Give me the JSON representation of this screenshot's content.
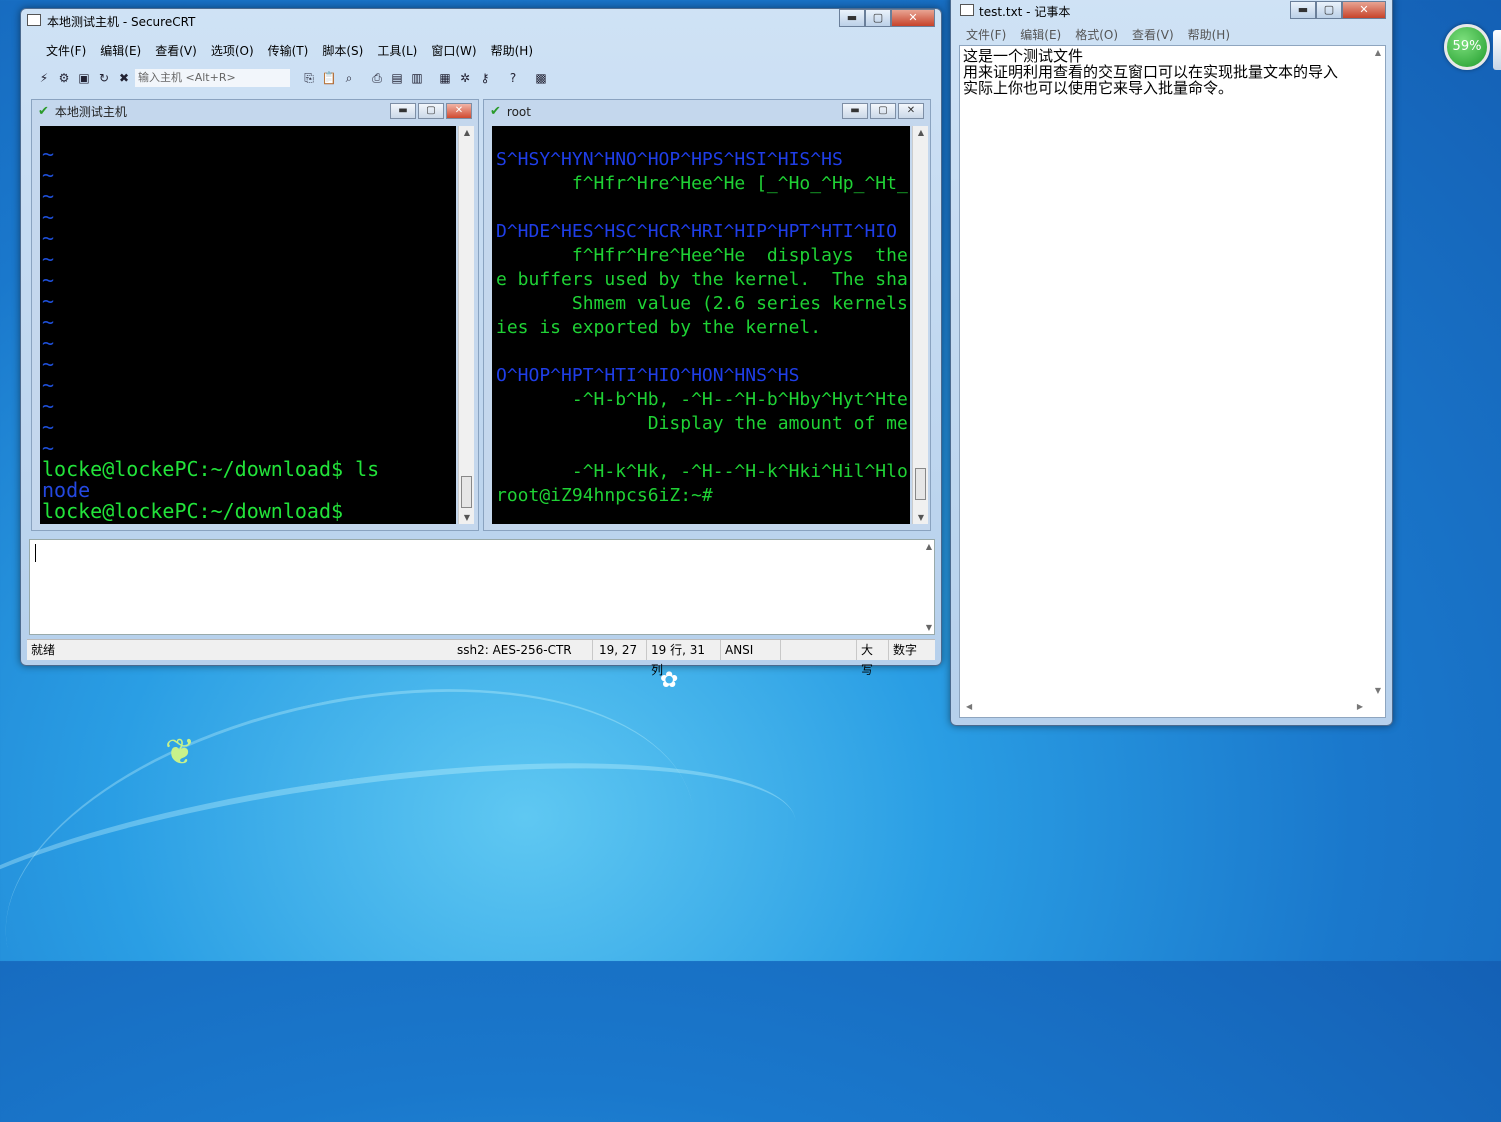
{
  "securecrt": {
    "title": "本地测试主机 - SecureCRT",
    "caption_min": "▬",
    "caption_max": "▢",
    "caption_close": "✕",
    "menu": [
      "文件(F)",
      "编辑(E)",
      "查看(V)",
      "选项(O)",
      "传输(T)",
      "脚本(S)",
      "工具(L)",
      "窗口(W)",
      "帮助(H)"
    ],
    "quick_connect_placeholder": "输入主机 <Alt+R>",
    "pane_left": {
      "title": "本地测试主机",
      "tilde_count": 15,
      "lines": [
        {
          "text": "locke@lockePC:~/download$ ls",
          "color": "green"
        },
        {
          "text": "node",
          "color": "blue"
        },
        {
          "text": "locke@lockePC:~/download$",
          "color": "green"
        }
      ]
    },
    "pane_right": {
      "title": "root",
      "lines": [
        {
          "text": "S^HSY^HYN^HNO^HOP^HPS^HSI^HIS^HS",
          "color": "blue"
        },
        {
          "text": "       f^Hfr^Hre^Hee^He [_^Ho_^Hp_^Ht_",
          "color": "green"
        },
        {
          "text": "",
          "color": "green"
        },
        {
          "text": "D^HDE^HES^HSC^HCR^HRI^HIP^HPT^HTI^HIO",
          "color": "blue"
        },
        {
          "text": "       f^Hfr^Hre^Hee^He  displays  the",
          "color": "green"
        },
        {
          "text": "e buffers used by the kernel.  The sha",
          "color": "green"
        },
        {
          "text": "       Shmem value (2.6 series kernels",
          "color": "green"
        },
        {
          "text": "ies is exported by the kernel.",
          "color": "green"
        },
        {
          "text": "",
          "color": "green"
        },
        {
          "text": "O^HOP^HPT^HTI^HIO^HON^HNS^HS",
          "color": "blue"
        },
        {
          "text": "       -^H-b^Hb, -^H--^H-b^Hby^Hyt^Hte",
          "color": "green"
        },
        {
          "text": "              Display the amount of me",
          "color": "green"
        },
        {
          "text": "",
          "color": "green"
        },
        {
          "text": "       -^H-k^Hk, -^H--^H-k^Hki^Hil^Hlo",
          "color": "green"
        },
        {
          "text": "root@iZ94hnpcs6iZ:~#",
          "color": "green"
        }
      ]
    },
    "status": {
      "ready": "就绪",
      "protocol": "ssh2: AES-256-CTR",
      "position": "19,  27",
      "row_col": "19 行, 31 列",
      "encoding": "ANSI",
      "caps": "大写",
      "num": "数字"
    }
  },
  "notepad": {
    "title": "test.txt - 记事本",
    "menu": [
      "文件(F)",
      "编辑(E)",
      "格式(O)",
      "查看(V)",
      "帮助(H)"
    ],
    "content": "这是一个测试文件\n用来证明利用查看的交互窗口可以在实现批量文本的导入\n实际上你也可以使用它来导入批量命令。"
  },
  "battery": {
    "percent": "59%"
  },
  "colors": {
    "term_green": "#1fd235",
    "term_blue": "#1f3ee8",
    "terminal_bg": "#000000"
  }
}
